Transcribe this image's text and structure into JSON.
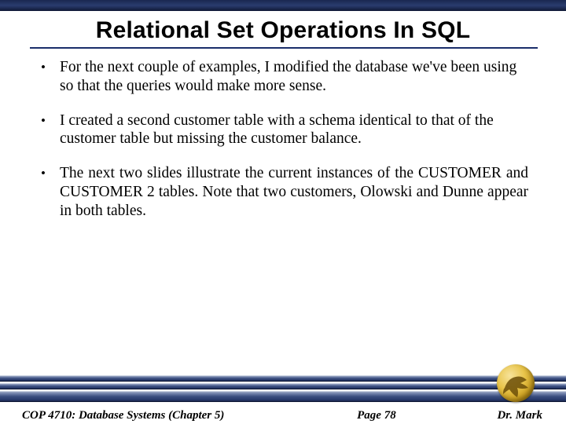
{
  "title": "Relational Set Operations In SQL",
  "bullets": [
    "For the next couple of examples, I modified the database we've been using so that the queries would make more sense.",
    "I created a second customer table with a schema identical to that of the customer table but missing the customer balance.",
    "The next two slides illustrate the current instances of the CUSTOMER and CUSTOMER 2 tables.   Note that two customers, Olowski and Dunne appear in both tables."
  ],
  "footer": {
    "course": "COP 4710: Database Systems  (Chapter 5)",
    "page": "Page 78",
    "author": "Dr. Mark"
  }
}
